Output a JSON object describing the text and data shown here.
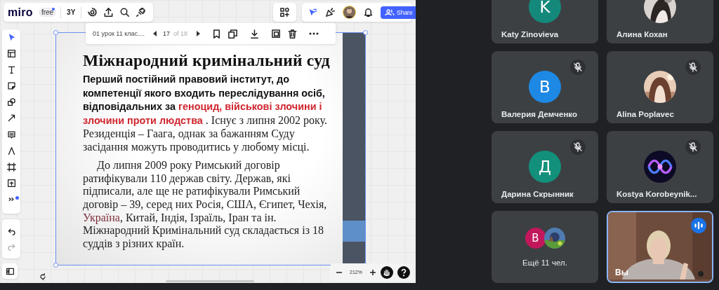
{
  "board": {
    "logo": "miro",
    "plan": "free",
    "board_label": "3Y",
    "share": "Share",
    "frame_bar": {
      "title": "01 урок 11 клас....",
      "current": "17",
      "total": "of 18"
    },
    "zoom": "212%",
    "slide": {
      "title": "Міжнародний кримінальний суд",
      "paragraphs": [
        [
          {
            "kind": "bold",
            "text": "Перший постійний правовий інститут, до компетенції якого входить переслідування осіб, відповідальних за "
          },
          {
            "kind": "bold-red",
            "text": "геноцид, військові злочини і злочини проти людства"
          },
          {
            "kind": "plain",
            "text": " . Існує з липня 2002 року. Резиденція – Гаага, однак за бажанням Суду засідання можуть проводитись у любому місці."
          }
        ],
        [
          {
            "kind": "plain",
            "text": "До липня 2009 року Римський договір ратифікували 110 держав світу. Держав, які підписали, але ще не ратифікували Римський договір – 39, серед них Росія, США, Єгипет, Чехія, "
          },
          {
            "kind": "dark-red",
            "text": "Україна"
          },
          {
            "kind": "plain",
            "text": ", Китай, Індія, Ізраїль, Іран та ін. Міжнародний Кримінальний суд складається із 18 суддів з різних країн."
          }
        ]
      ]
    }
  },
  "participants": [
    {
      "name": "Katy Zinovieva",
      "avatar": {
        "kind": "letter",
        "letter": "K",
        "color": "#14897b"
      }
    },
    {
      "name": "Алина Кохан",
      "avatar": {
        "kind": "picture"
      }
    },
    {
      "name": "Валерия Демченко",
      "avatar": {
        "kind": "letter",
        "letter": "В",
        "color": "#1e88e5"
      },
      "muted": true
    },
    {
      "name": "Alina Poplavec",
      "avatar": {
        "kind": "picture"
      },
      "muted": true
    },
    {
      "name": "Дарина Скрынник",
      "avatar": {
        "kind": "letter",
        "letter": "Д",
        "color": "#12907c"
      },
      "muted": true
    },
    {
      "name": "Kostya Korobeynik...",
      "avatar": {
        "kind": "picture"
      },
      "muted": true
    }
  ],
  "more": {
    "label": "Ещё 11 чел.",
    "avatars": [
      {
        "kind": "letter",
        "letter": "В",
        "color": "#c2185b"
      },
      {
        "kind": "picture"
      }
    ]
  },
  "self": {
    "name": "Вы",
    "speaking": true
  }
}
